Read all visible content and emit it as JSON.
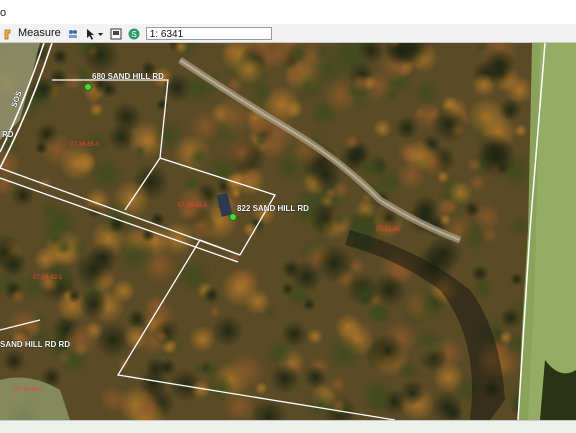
{
  "topbar": {
    "partial_text": "o"
  },
  "toolbar": {
    "measure_label": "Measure",
    "scale_value": "1: 6341"
  },
  "icons": {
    "measure": "ruler-icon",
    "identify": "identify-icon",
    "select": "select-arrow-icon",
    "dropdown": "chevron-down-icon",
    "print": "print-icon",
    "zoom_scale": "scale-icon"
  },
  "map": {
    "road_labels": {
      "west_vertical": "RD",
      "west_route": "SOS",
      "lower_left": "SAND HILL RD RD"
    },
    "addresses": {
      "north": "680 SAND HILL RD",
      "center": "822 SAND HILL RD"
    },
    "parcels": {
      "p1": "07-16-65-5",
      "p2": "07-16-62-5",
      "p3": "07-16-45",
      "p4": "07-16-42-1",
      "p5": "07-16-43-7"
    },
    "colors": {
      "parcel_line": "#ffffff",
      "parcel_label": "#ff3b3b",
      "address_label": "#ffffff",
      "marker": "#4bd63a"
    }
  }
}
